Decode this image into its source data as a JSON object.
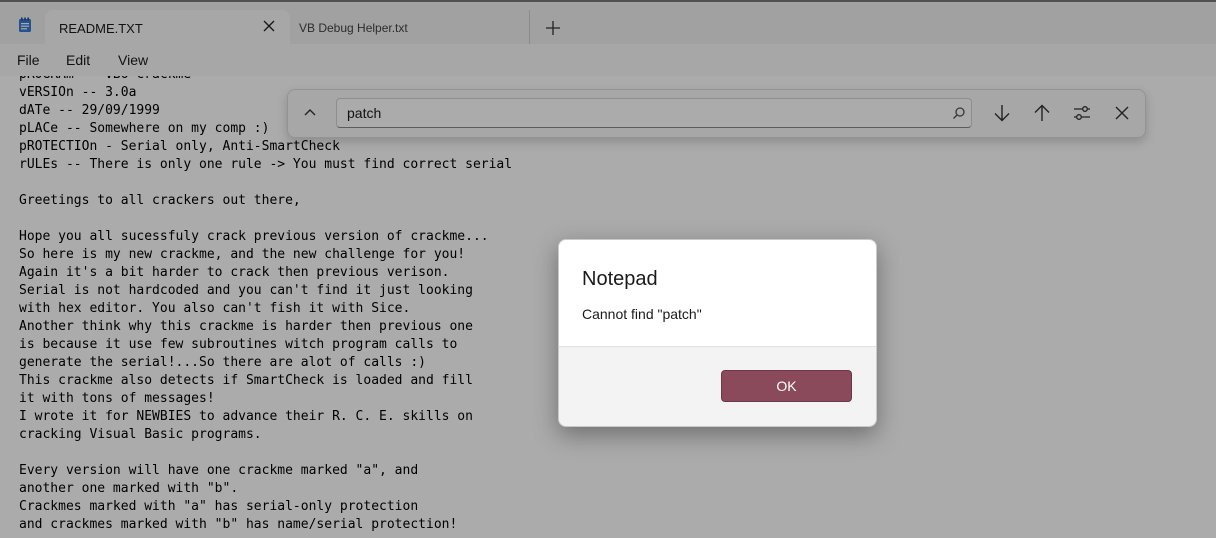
{
  "tabs": [
    {
      "label": "README.TXT",
      "active": true
    },
    {
      "label": "VB Debug Helper.txt",
      "active": false
    }
  ],
  "menu": [
    "File",
    "Edit",
    "View"
  ],
  "editor": {
    "lines": [
      "pROGRAm -- VBo crackme",
      "vERSIOn -- 3.0a",
      "dATe -- 29/09/1999",
      "pLACe -- Somewhere on my comp :)",
      "pROTECTIOn - Serial only, Anti-SmartCheck",
      "rULEs -- There is only one rule -> You must find correct serial",
      "",
      "Greetings to all crackers out there,",
      "",
      "Hope you all sucessfuly crack previous version of crackme...",
      "So here is my new crackme, and the new challenge for you!",
      "Again it's a bit harder to crack then previous verison.",
      "Serial is not hardcoded and you can't find it just looking",
      "with hex editor. You also can't fish it with Sice.",
      "Another think why this crackme is harder then previous one",
      "is because it use few subroutines witch program calls to",
      "generate the serial!...So there are alot of calls :)",
      "This crackme also detects if SmartCheck is loaded and fill",
      "it with tons of messages!",
      "I wrote it for NEWBIES to advance their R. C. E. skills on",
      "cracking Visual Basic programs.",
      "",
      "Every version will have one crackme marked \"a\", and",
      "another one marked with \"b\".",
      "Crackmes marked with \"a\" has serial-only protection",
      "and crackmes marked with \"b\" has name/serial protection!"
    ]
  },
  "find": {
    "value": "patch"
  },
  "dialog": {
    "title": "Notepad",
    "message": "Cannot find \"patch\"",
    "ok_label": "OK"
  },
  "colors": {
    "accent": "#8b4a5c"
  }
}
